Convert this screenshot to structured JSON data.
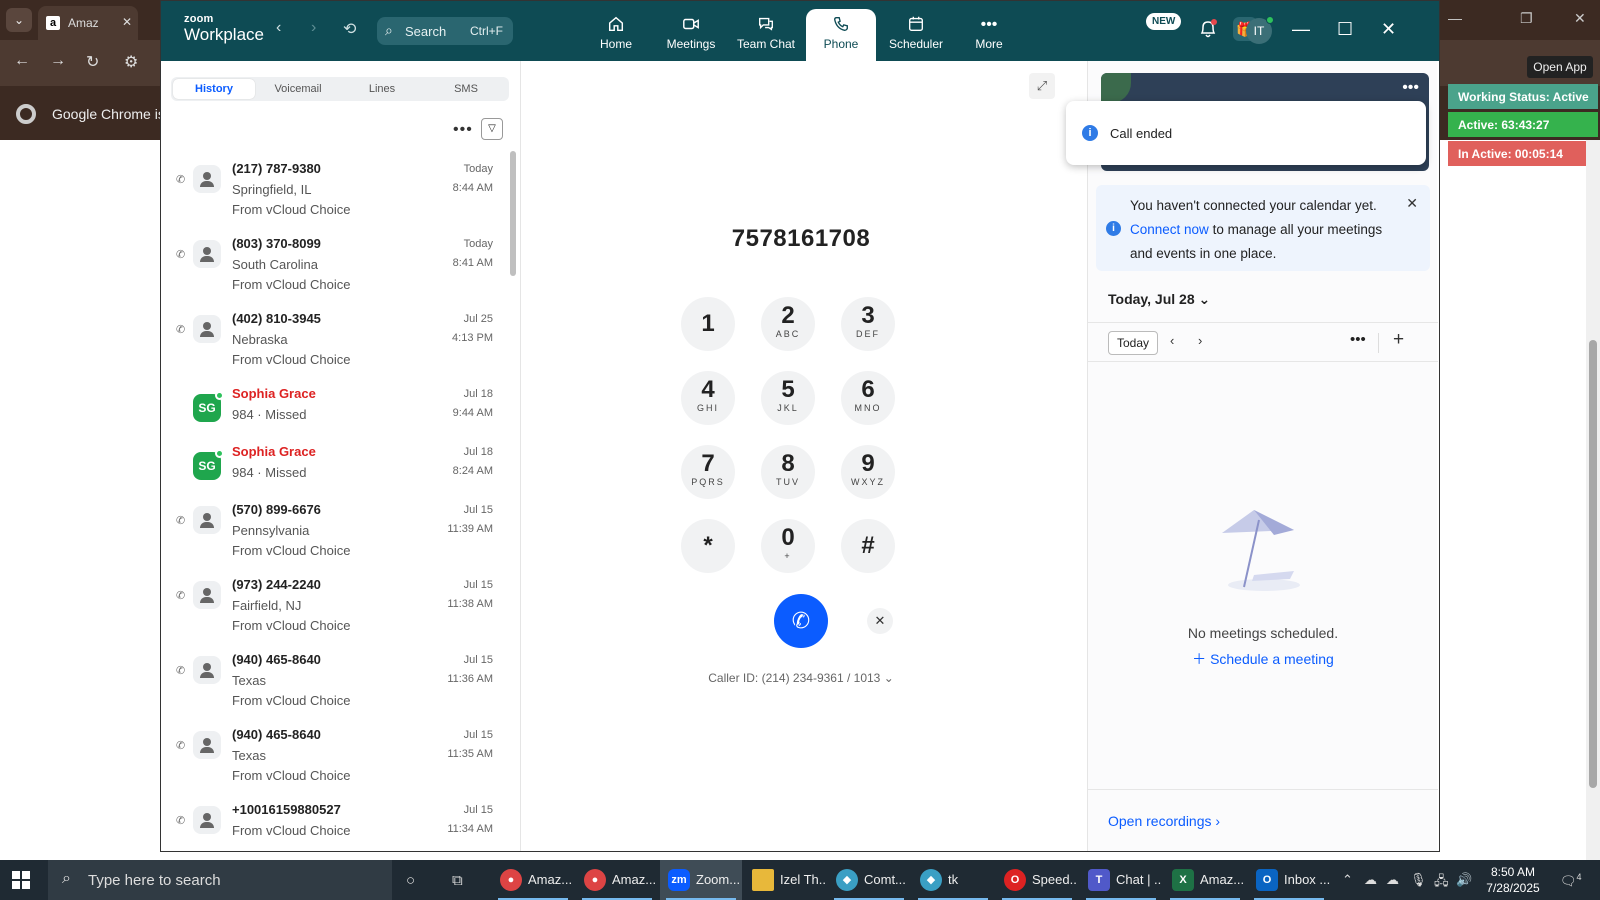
{
  "browser": {
    "tab_title": "Amaz",
    "info_bar": "Google Chrome isn",
    "open_app": "Open App"
  },
  "status_widgets": [
    {
      "label": "Working Status: Active",
      "color": "#4aa38b"
    },
    {
      "label": "Active: 63:43:27",
      "color": "#35b24d"
    },
    {
      "label": "In Active: 00:05:14",
      "color": "#e0605c"
    }
  ],
  "zoom": {
    "logo_top": "zoom",
    "logo_bottom": "Workplace",
    "search": {
      "label": "Search",
      "shortcut": "Ctrl+F"
    },
    "tabs": [
      {
        "label": "Home",
        "icon": "home-icon"
      },
      {
        "label": "Meetings",
        "icon": "video-icon"
      },
      {
        "label": "Team Chat",
        "icon": "chat-icon"
      },
      {
        "label": "Phone",
        "icon": "phone-icon",
        "active": true
      },
      {
        "label": "Scheduler",
        "icon": "calendar-icon"
      },
      {
        "label": "More",
        "icon": "more-icon"
      }
    ],
    "new_badge": "NEW",
    "avatar_initials": "IT"
  },
  "history": {
    "segments": [
      "History",
      "Voicemail",
      "Lines",
      "SMS"
    ],
    "items": [
      {
        "name": "(217) 787-9380",
        "line2": "Springfield, IL",
        "line3": "From vCloud Choice",
        "date": "Today",
        "time": "8:44 AM"
      },
      {
        "name": "(803) 370-8099",
        "line2": "South Carolina",
        "line3": "From vCloud Choice",
        "date": "Today",
        "time": "8:41 AM"
      },
      {
        "name": "(402) 810-3945",
        "line2": "Nebraska",
        "line3": "From vCloud Choice",
        "date": "Jul 25",
        "time": "4:13 PM"
      },
      {
        "name": "Sophia Grace",
        "initials": "SG",
        "line2": "984 · Missed",
        "date": "Jul 18",
        "time": "9:44 AM"
      },
      {
        "name": "Sophia Grace",
        "initials": "SG",
        "line2": "984 · Missed",
        "date": "Jul 18",
        "time": "8:24 AM"
      },
      {
        "name": "(570) 899-6676",
        "line2": "Pennsylvania",
        "line3": "From vCloud Choice",
        "date": "Jul 15",
        "time": "11:39 AM"
      },
      {
        "name": "(973) 244-2240",
        "line2": "Fairfield, NJ",
        "line3": "From vCloud Choice",
        "date": "Jul 15",
        "time": "11:38 AM"
      },
      {
        "name": "(940) 465-8640",
        "line2": "Texas",
        "line3": "From vCloud Choice",
        "date": "Jul 15",
        "time": "11:36 AM"
      },
      {
        "name": "(940) 465-8640",
        "line2": "Texas",
        "line3": "From vCloud Choice",
        "date": "Jul 15",
        "time": "11:35 AM"
      },
      {
        "name": "+10016159880527",
        "line2": "From vCloud Choice",
        "date": "Jul 15",
        "time": "11:34 AM"
      }
    ]
  },
  "dialpad": {
    "number": "7578161708",
    "keys": [
      {
        "digit": "1",
        "sub": ""
      },
      {
        "digit": "2",
        "sub": "ABC"
      },
      {
        "digit": "3",
        "sub": "DEF"
      },
      {
        "digit": "4",
        "sub": "GHI"
      },
      {
        "digit": "5",
        "sub": "JKL"
      },
      {
        "digit": "6",
        "sub": "MNO"
      },
      {
        "digit": "7",
        "sub": "PQRS"
      },
      {
        "digit": "8",
        "sub": "TUV"
      },
      {
        "digit": "9",
        "sub": "WXYZ"
      },
      {
        "digit": "*",
        "sub": ""
      },
      {
        "digit": "0",
        "sub": "+"
      },
      {
        "digit": "#",
        "sub": ""
      }
    ],
    "caller_id": "Caller ID: (214) 234-9361 / 1013"
  },
  "right_panel": {
    "toast": "Call ended",
    "calendar_note_pre": "You haven't connected your calendar yet. ",
    "calendar_note_link": "Connect now",
    "calendar_note_post": " to manage all your meetings and events in one place.",
    "day_header": "Today, Jul 28",
    "today_button": "Today",
    "no_meetings": "No meetings scheduled.",
    "schedule_link": "Schedule a meeting",
    "open_recordings": "Open recordings"
  },
  "taskbar": {
    "search_placeholder": "Type here to search",
    "apps": [
      {
        "label": "Amaz...",
        "color": "#d44"
      },
      {
        "label": "Amaz...",
        "color": "#d44"
      },
      {
        "label": "Zoom...",
        "color": "#0b5cff",
        "active": true
      },
      {
        "label": "Izel Th...",
        "color": "#e8b83a"
      },
      {
        "label": "Comt...",
        "color": "#3a9fc4"
      },
      {
        "label": "tk",
        "color": "#3a9fc4"
      },
      {
        "label": "Speed...",
        "color": "#d22"
      },
      {
        "label": "Chat | ...",
        "color": "#5059c9"
      },
      {
        "label": "Amaz...",
        "color": "#1e7145"
      },
      {
        "label": "Inbox ...",
        "color": "#0a64c2"
      }
    ],
    "time": "8:50 AM",
    "date": "7/28/2025",
    "notif_count": "4"
  }
}
